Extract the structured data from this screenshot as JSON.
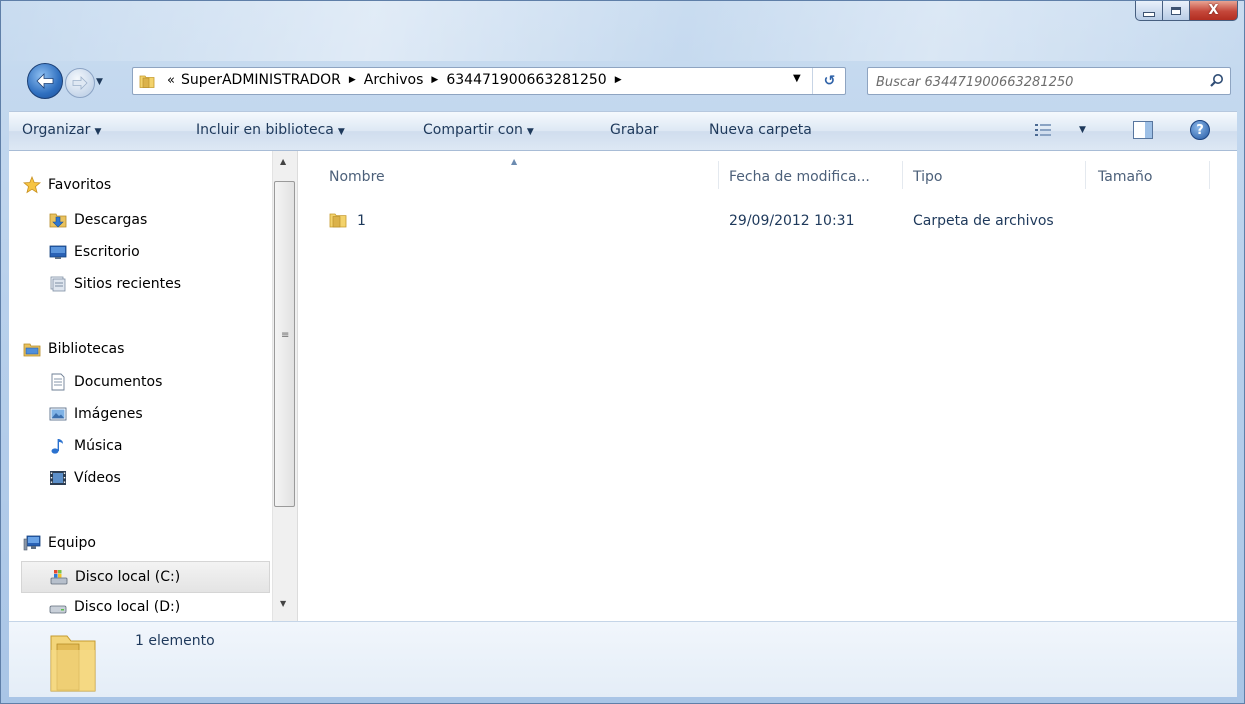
{
  "window": {
    "minimize_icon": "minimize-icon",
    "maximize_icon": "maximize-icon",
    "close_glyph": "X"
  },
  "nav": {
    "back_icon": "back-arrow-icon",
    "forward_icon": "forward-arrow-icon",
    "address": {
      "overflow_marker": "«",
      "crumbs": [
        "SuperADMINISTRADOR",
        "Archivos",
        "634471900663281250"
      ],
      "refresh_icon": "refresh-icon"
    },
    "search": {
      "placeholder": "Buscar 634471900663281250"
    }
  },
  "toolbar": {
    "organize": "Organizar",
    "include_library": "Incluir en biblioteca",
    "share_with": "Compartir con",
    "burn": "Grabar",
    "new_folder": "Nueva carpeta",
    "views_icon": "view-list-icon",
    "preview_icon": "preview-pane-icon",
    "help_glyph": "?"
  },
  "sidebar": {
    "favorites": {
      "label": "Favoritos",
      "items": [
        {
          "label": "Descargas",
          "icon": "downloads-icon"
        },
        {
          "label": "Escritorio",
          "icon": "desktop-icon"
        },
        {
          "label": "Sitios recientes",
          "icon": "recent-places-icon"
        }
      ]
    },
    "libraries": {
      "label": "Bibliotecas",
      "items": [
        {
          "label": "Documentos",
          "icon": "documents-icon"
        },
        {
          "label": "Imágenes",
          "icon": "pictures-icon"
        },
        {
          "label": "Música",
          "icon": "music-icon"
        },
        {
          "label": "Vídeos",
          "icon": "videos-icon"
        }
      ]
    },
    "computer": {
      "label": "Equipo",
      "items": [
        {
          "label": "Disco local (C:)",
          "icon": "system-drive-icon",
          "selected": true
        },
        {
          "label": "Disco local (D:)",
          "icon": "drive-icon"
        }
      ]
    }
  },
  "file_list": {
    "columns": [
      "Nombre",
      "Fecha de modifica...",
      "Tipo",
      "Tamaño"
    ],
    "rows": [
      {
        "name": "1",
        "modified": "29/09/2012 10:31",
        "type": "Carpeta de archivos",
        "size": ""
      }
    ]
  },
  "details": {
    "summary": "1 elemento"
  },
  "colors": {
    "accent": "#1e395b",
    "frame": "#b9d1ec",
    "close": "#c4473a"
  }
}
